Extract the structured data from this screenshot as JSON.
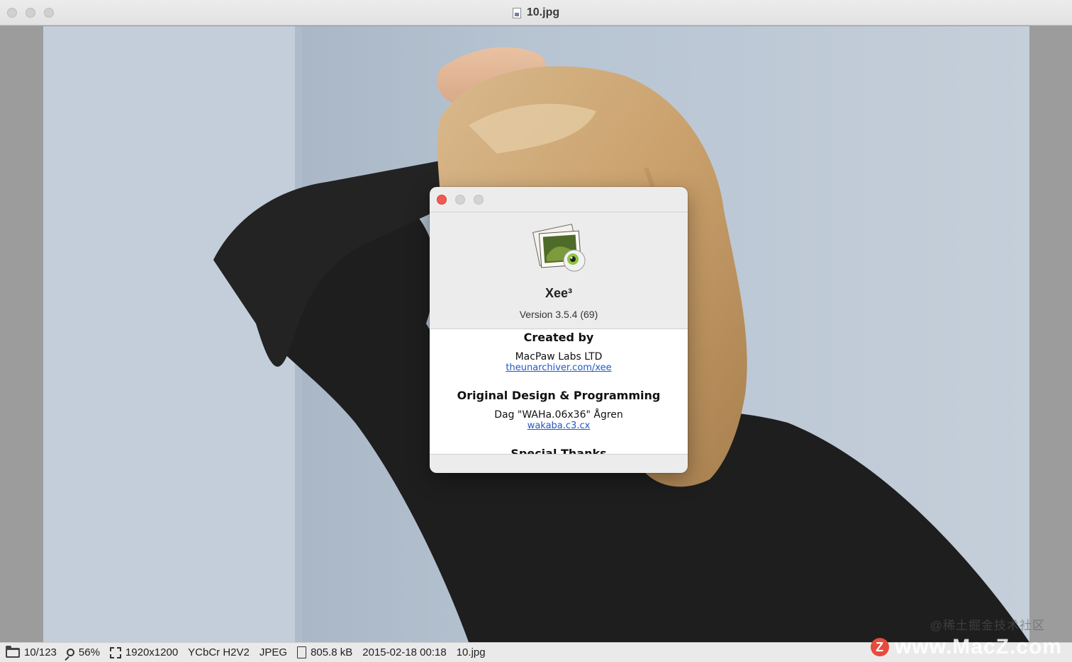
{
  "window": {
    "title": "10.jpg"
  },
  "about": {
    "app_name": "Xee³",
    "version": "Version 3.5.4 (69)",
    "credits": [
      {
        "heading": "Created by",
        "name": "MacPaw Labs LTD",
        "link": "theunarchiver.com/xee"
      },
      {
        "heading": "Original Design & Programming",
        "name": "Dag \"WAHa.06x36\" Ågren",
        "link": "wakaba.c3.cx"
      },
      {
        "heading": "Special Thanks"
      }
    ]
  },
  "statusbar": {
    "position": "10/123",
    "zoom": "56%",
    "dimensions": "1920x1200",
    "color_space": "YCbCr H2V2",
    "format": "JPEG",
    "file_size": "805.8 kB",
    "date": "2015-02-18 00:18",
    "filename": "10.jpg"
  },
  "watermark": {
    "text": "www.MacZ.com",
    "logo_letter": "Z",
    "community": "@稀土掘金技术社区"
  }
}
